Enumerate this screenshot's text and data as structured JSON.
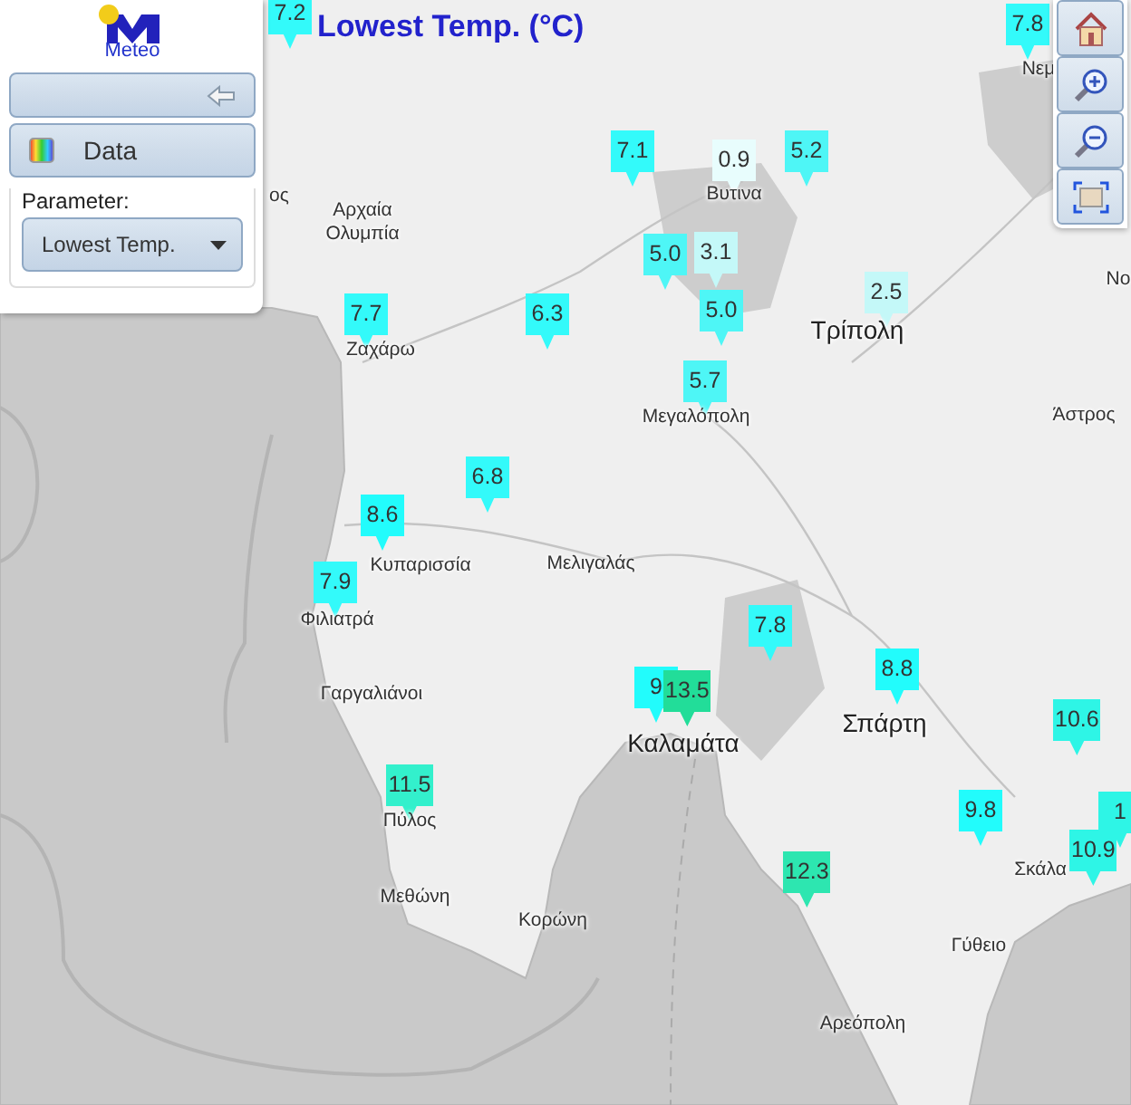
{
  "logo": {
    "text": "Meteo"
  },
  "panel": {
    "data_button": {
      "label": "Data"
    },
    "parameter": {
      "label": "Parameter:",
      "value": "Lowest Temp."
    }
  },
  "map": {
    "title": "Lowest Temp. (°C)",
    "places": [
      {
        "name": "ος"
      },
      {
        "name": "Νεμ"
      },
      {
        "name": "Αρχαία Ολυμπία"
      },
      {
        "name": "Βυτινα"
      },
      {
        "name": "Νο"
      },
      {
        "name": "Τρίπολη"
      },
      {
        "name": "Ζαχάρω"
      },
      {
        "name": "Μεγαλόπολη"
      },
      {
        "name": "Άστρος"
      },
      {
        "name": "Κυπαρισσία"
      },
      {
        "name": "Μελιγαλάς"
      },
      {
        "name": "Φιλιατρά"
      },
      {
        "name": "Γαργαλιάνοι"
      },
      {
        "name": "Σπάρτη"
      },
      {
        "name": "Καλαμάτα"
      },
      {
        "name": "Πύλος"
      },
      {
        "name": "Σκάλα"
      },
      {
        "name": "Μεθώνη"
      },
      {
        "name": "Κορώνη"
      },
      {
        "name": "Γύθειο"
      },
      {
        "name": "Αρεόπολη"
      }
    ],
    "markers": [
      {
        "value": "7.2",
        "color": "#33fafa"
      },
      {
        "value": "7.8",
        "color": "#33fafa"
      },
      {
        "value": "7.1",
        "color": "#33fafa"
      },
      {
        "value": "0.9",
        "color": "#e8fdfd"
      },
      {
        "value": "5.2",
        "color": "#4ef6f6"
      },
      {
        "value": "5.0",
        "color": "#4ef6f6"
      },
      {
        "value": "3.1",
        "color": "#c4f8f8"
      },
      {
        "value": "5.0",
        "color": "#4ef6f6"
      },
      {
        "value": "2.5",
        "color": "#c4f8f8"
      },
      {
        "value": "7.7",
        "color": "#33fafa"
      },
      {
        "value": "6.3",
        "color": "#33fafa"
      },
      {
        "value": "5.7",
        "color": "#4ef6f6"
      },
      {
        "value": "6.8",
        "color": "#33fafa"
      },
      {
        "value": "8.6",
        "color": "#22fcfc"
      },
      {
        "value": "7.9",
        "color": "#33fafa"
      },
      {
        "value": "7.8",
        "color": "#33fafa"
      },
      {
        "value": "8.8",
        "color": "#22fcfc"
      },
      {
        "value": "9",
        "color": "#22fcfc"
      },
      {
        "value": "13.5",
        "color": "#22dd99"
      },
      {
        "value": "10.6",
        "color": "#2ef5e6"
      },
      {
        "value": "9.8",
        "color": "#22fcfc"
      },
      {
        "value": "1",
        "color": "#2ef5e6"
      },
      {
        "value": "10.9",
        "color": "#2ef5e6"
      },
      {
        "value": "11.5",
        "color": "#33f0cc"
      },
      {
        "value": "12.3",
        "color": "#2de6b0"
      }
    ]
  }
}
